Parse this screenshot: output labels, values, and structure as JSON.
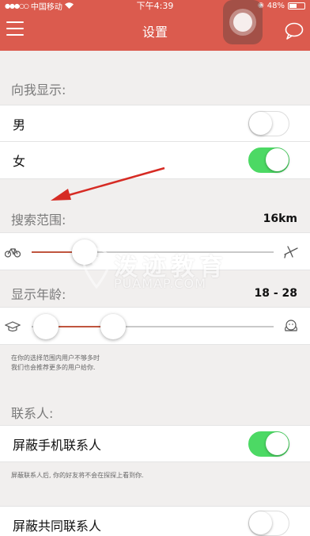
{
  "status_bar": {
    "carrier": "中国移动",
    "time": "下午4:39",
    "battery": "48%"
  },
  "navbar": {
    "title": "设置"
  },
  "show_to_me": {
    "header": "向我显示:",
    "male_label": "男",
    "male_enabled": false,
    "female_label": "女",
    "female_enabled": true
  },
  "search_range": {
    "header": "搜索范围:",
    "value": "16km",
    "slider_fraction": 0.22,
    "left_icon": "bicycle-icon",
    "right_icon": "airplane-icon"
  },
  "age_range": {
    "header": "显示年龄:",
    "value": "18 - 28",
    "left_icon": "graduation-cap-icon",
    "right_icon": "elder-icon",
    "note_line1": "在你的选择范围内用户不够多时",
    "note_line2": "我们也会推荐更多的用户给你."
  },
  "contacts": {
    "header": "联系人:",
    "block_phone_label": "屏蔽手机联系人",
    "block_phone_enabled": true,
    "block_phone_note": "屏蔽联系人后, 你的好友将不会在探探上看到你.",
    "block_common_label": "屏蔽共同联系人",
    "block_common_enabled": false
  },
  "watermark": {
    "main": "泼迹教育",
    "sub": "PUAMAP.COM"
  },
  "colors": {
    "primary": "#db5b4e",
    "toggle_on": "#4cd964",
    "slider_fill": "#c0553f"
  }
}
